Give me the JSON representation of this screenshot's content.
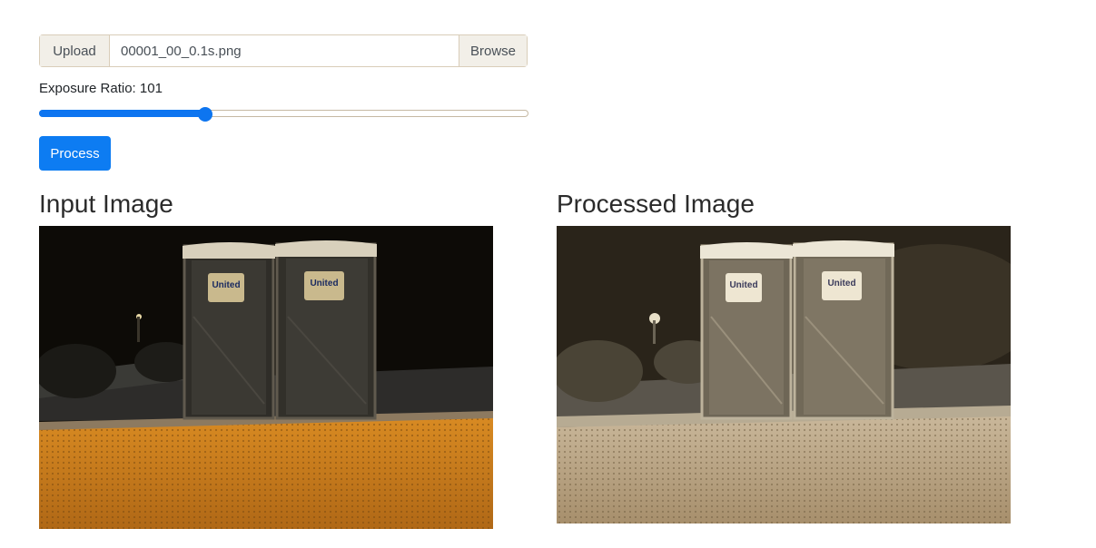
{
  "upload": {
    "label": "Upload",
    "file_name": "00001_00_0.1s.png",
    "browse_label": "Browse"
  },
  "exposure": {
    "label": "Exposure Ratio: 101",
    "value": 101,
    "fill_fraction": 0.34
  },
  "process_button": "Process",
  "sections": {
    "input_title": "Input Image",
    "output_title": "Processed Image"
  },
  "images": {
    "input_sign_text": "United",
    "output_sign_text": "United"
  },
  "colors": {
    "accent": "#0d7cf2",
    "input_ground": "#c27a1f",
    "input_sky": "#0d0b07",
    "output_ground": "#b7a487",
    "output_sky": "#2a241a"
  }
}
